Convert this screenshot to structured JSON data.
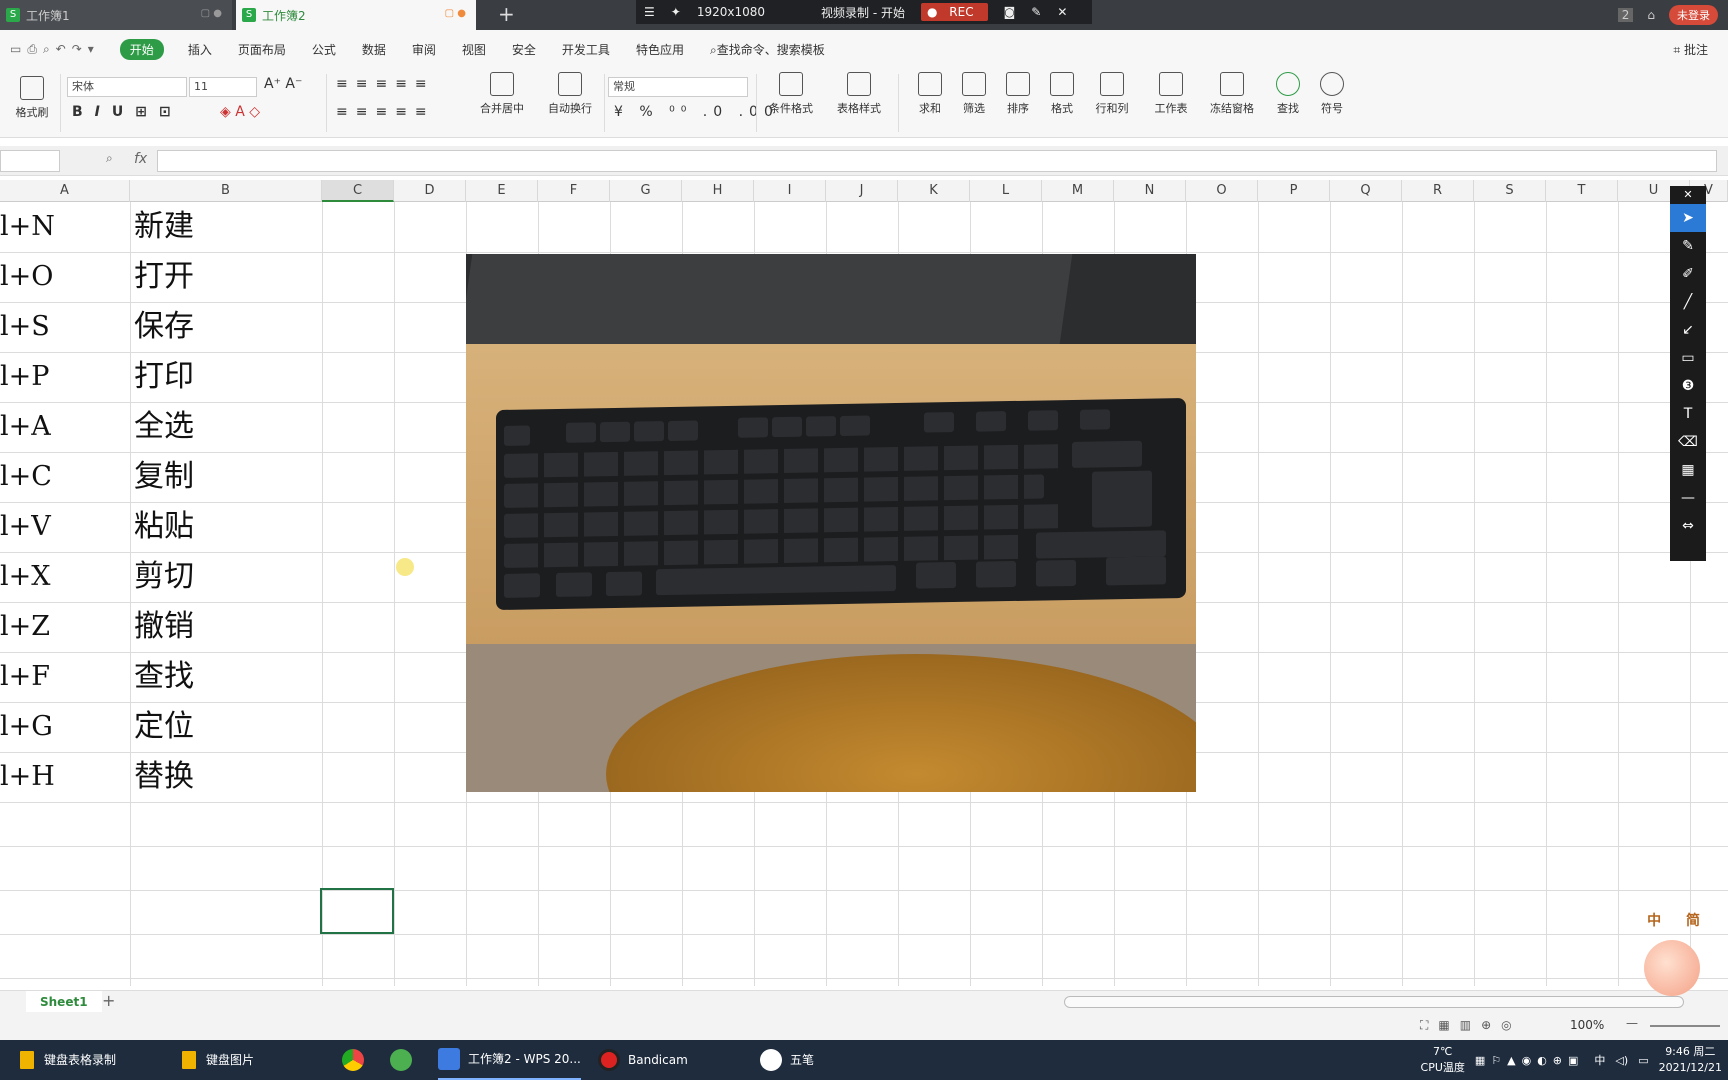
{
  "tabs": [
    {
      "label": "工作簿1"
    },
    {
      "label": "工作簿2"
    }
  ],
  "recorder": {
    "resolution": "1920x1080",
    "status": "视频录制 - 开始",
    "rec_label": "REC"
  },
  "titlebar": {
    "badge": "2",
    "login": "未登录"
  },
  "menu": {
    "start": "开始",
    "items": [
      "插入",
      "页面布局",
      "公式",
      "数据",
      "审阅",
      "视图",
      "安全",
      "开发工具",
      "特色应用"
    ],
    "search": "查找命令、搜索模板",
    "comment": "批注"
  },
  "ribbon": {
    "format_painter": "格式刷",
    "font_name": "宋体",
    "font_size": "11",
    "merge_center": "合并居中",
    "wrap_text": "自动换行",
    "number_format": "常规",
    "cond_format": "条件格式",
    "table_style": "表格样式",
    "sum": "求和",
    "filter": "筛选",
    "sort": "排序",
    "format": "格式",
    "rowcol": "行和列",
    "worksheet": "工作表",
    "freeze": "冻结窗格",
    "find": "查找",
    "symbol": "符号",
    "fx": "fx"
  },
  "columns": [
    "A",
    "B",
    "C",
    "D",
    "E",
    "F",
    "G",
    "H",
    "I",
    "J",
    "K",
    "L",
    "M",
    "N",
    "O",
    "P",
    "Q",
    "R",
    "S",
    "T",
    "U",
    "V"
  ],
  "rows": [
    {
      "key": "l+N",
      "action": "新建"
    },
    {
      "key": "l+O",
      "action": "打开"
    },
    {
      "key": "l+S",
      "action": "保存"
    },
    {
      "key": "l+P",
      "action": "打印"
    },
    {
      "key": "l+A",
      "action": "全选"
    },
    {
      "key": "l+C",
      "action": "复制"
    },
    {
      "key": "l+V",
      "action": "粘贴"
    },
    {
      "key": "l+X",
      "action": "剪切"
    },
    {
      "key": "l+Z",
      "action": "撤销"
    },
    {
      "key": "l+F",
      "action": "查找"
    },
    {
      "key": "l+G",
      "action": "定位"
    },
    {
      "key": "l+H",
      "action": "替换"
    }
  ],
  "sheet": {
    "name": "Sheet1"
  },
  "status": {
    "zoom": "100%"
  },
  "taskbar": {
    "items": [
      {
        "label": "键盘表格录制"
      },
      {
        "label": "键盘图片"
      },
      {
        "label": "工作簿2 - WPS 20..."
      },
      {
        "label": "Bandicam"
      },
      {
        "label": "五笔"
      }
    ],
    "temp": "7℃",
    "temp_label": "CPU温度",
    "ime": "中",
    "time": "9:46 周二",
    "date": "2021/12/21"
  },
  "logo": {
    "text": "中 简"
  }
}
